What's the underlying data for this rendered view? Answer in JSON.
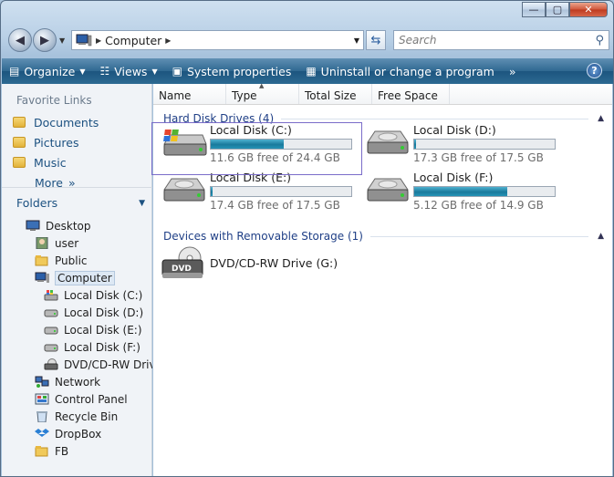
{
  "window": {
    "caps": {
      "minimize": "—",
      "maximize": "▢",
      "close": "✕"
    }
  },
  "nav": {
    "back": "◀",
    "forward": "▶"
  },
  "address": {
    "crumb": "Computer"
  },
  "search": {
    "placeholder": "Search"
  },
  "toolbar": {
    "organize": "Organize",
    "views": "Views",
    "system_properties": "System properties",
    "uninstall": "Uninstall or change a program",
    "overflow": "»",
    "help": "?"
  },
  "sidebar": {
    "favorite_links_title": "Favorite Links",
    "favorites": [
      "Documents",
      "Pictures",
      "Music"
    ],
    "more": "More",
    "folders_title": "Folders",
    "tree": [
      {
        "label": "Desktop",
        "indent": 0,
        "icon": "desktop-icon"
      },
      {
        "label": "user",
        "indent": 1,
        "icon": "user-icon"
      },
      {
        "label": "Public",
        "indent": 1,
        "icon": "folder-icon"
      },
      {
        "label": "Computer",
        "indent": 1,
        "icon": "computer-icon",
        "selected": true
      },
      {
        "label": "Local Disk (C:)",
        "indent": 2,
        "icon": "system-drive-icon"
      },
      {
        "label": "Local Disk (D:)",
        "indent": 2,
        "icon": "drive-icon"
      },
      {
        "label": "Local Disk (E:)",
        "indent": 2,
        "icon": "drive-icon"
      },
      {
        "label": "Local Disk (F:)",
        "indent": 2,
        "icon": "drive-icon"
      },
      {
        "label": "DVD/CD-RW Drive",
        "indent": 2,
        "icon": "dvd-drive-icon"
      },
      {
        "label": "Network",
        "indent": 1,
        "icon": "network-icon"
      },
      {
        "label": "Control Panel",
        "indent": 1,
        "icon": "control-panel-icon"
      },
      {
        "label": "Recycle Bin",
        "indent": 1,
        "icon": "recycle-bin-icon"
      },
      {
        "label": "DropBox",
        "indent": 1,
        "icon": "dropbox-icon"
      },
      {
        "label": "FB",
        "indent": 1,
        "icon": "folder-icon"
      }
    ]
  },
  "columns": [
    "Name",
    "Type",
    "Total Size",
    "Free Space"
  ],
  "groups": {
    "hard_disks": "Hard Disk Drives (4)",
    "removable": "Devices with Removable Storage (1)"
  },
  "drives": [
    {
      "name": "Local Disk (C:)",
      "free": "11.6 GB free of 24.4 GB",
      "used_fraction": 0.52,
      "system": true
    },
    {
      "name": "Local Disk (D:)",
      "free": "17.3 GB free of 17.5 GB",
      "used_fraction": 0.01
    },
    {
      "name": "Local Disk (E:)",
      "free": "17.4 GB free of 17.5 GB",
      "used_fraction": 0.01
    },
    {
      "name": "Local Disk (F:)",
      "free": "5.12 GB free of 14.9 GB",
      "used_fraction": 0.66
    }
  ],
  "removable": {
    "name": "DVD/CD-RW Drive (G:)",
    "icon_text": "DVD"
  }
}
